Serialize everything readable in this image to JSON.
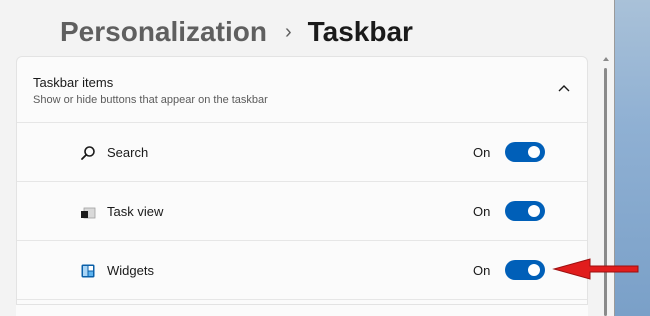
{
  "breadcrumb": {
    "parent": "Personalization",
    "separator": "›",
    "current": "Taskbar"
  },
  "section": {
    "title": "Taskbar items",
    "subtitle": "Show or hide buttons that appear on the taskbar",
    "expanded": true
  },
  "items": [
    {
      "label": "Search",
      "state": "On",
      "toggle_on": true,
      "icon": "search-icon"
    },
    {
      "label": "Task view",
      "state": "On",
      "toggle_on": true,
      "icon": "task-view-icon"
    },
    {
      "label": "Widgets",
      "state": "On",
      "toggle_on": true,
      "icon": "widgets-icon"
    }
  ],
  "colors": {
    "accent": "#005fb8",
    "annotation_arrow": "#e11d1d"
  }
}
